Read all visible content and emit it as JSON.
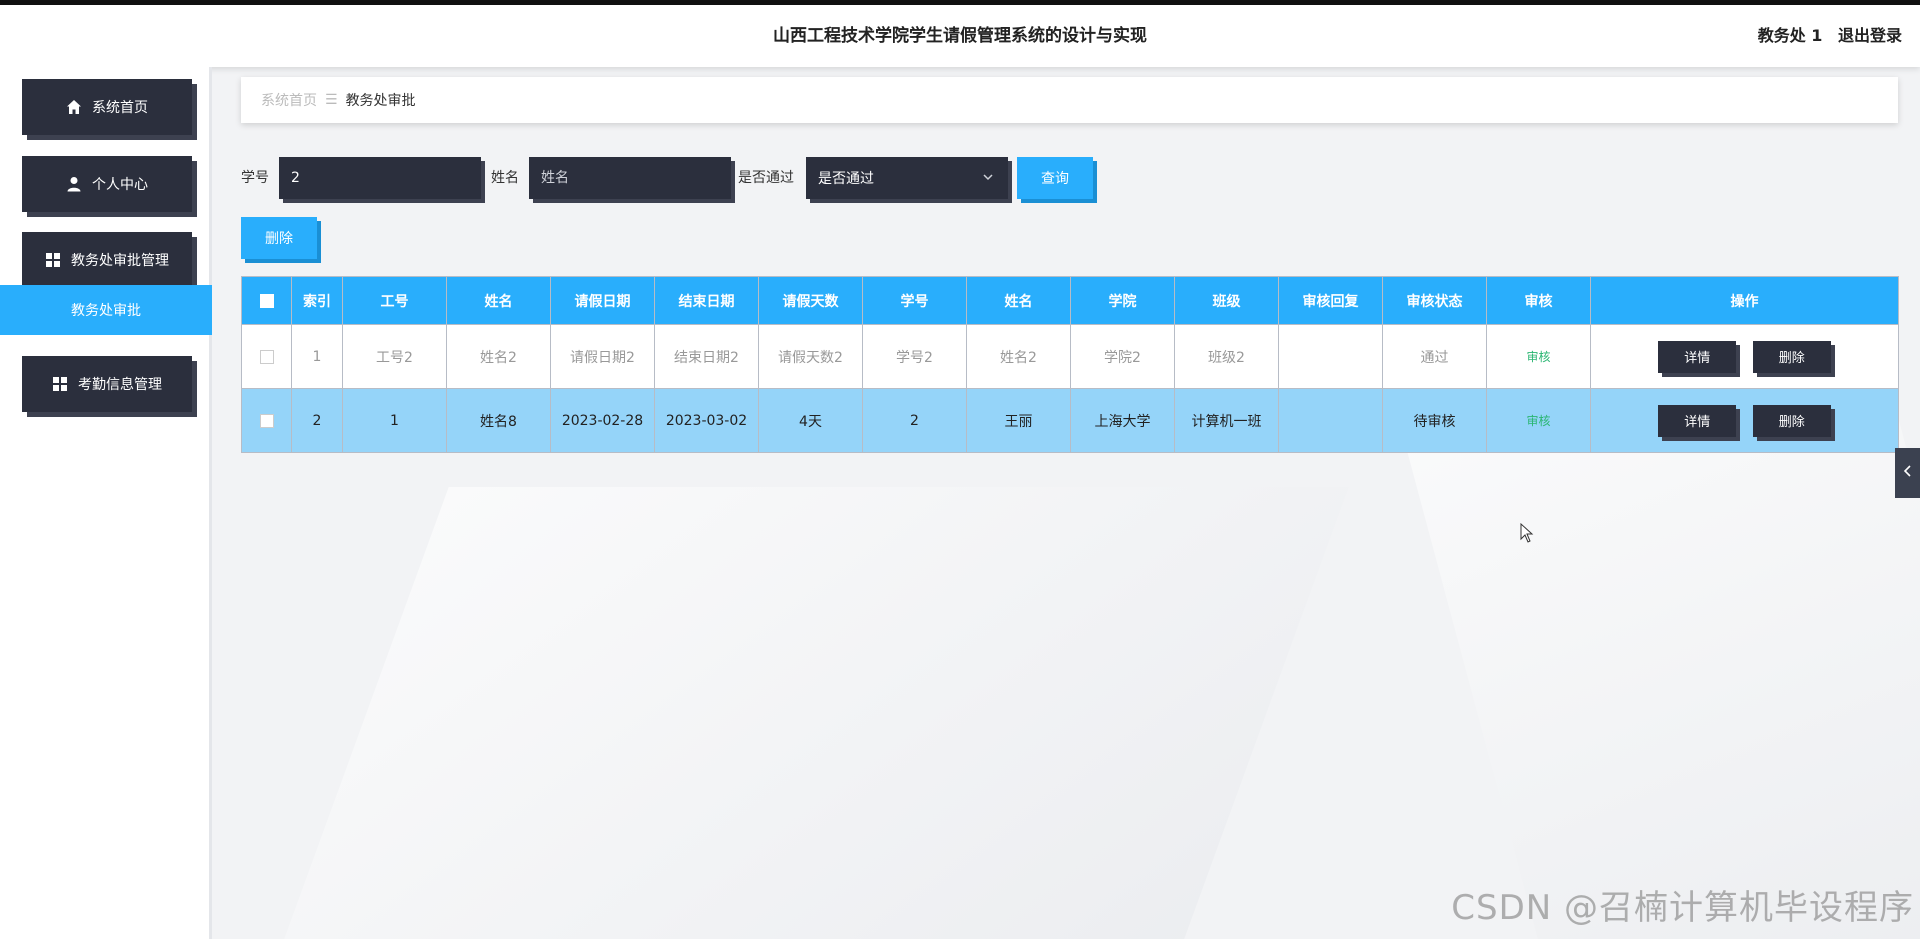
{
  "header": {
    "title": "山西工程技术学院学生请假管理系统的设计与实现",
    "user_name": "教务处 1",
    "logout_label": "退出登录"
  },
  "sidebar": {
    "items": [
      {
        "label": "系统首页",
        "icon": "home-icon"
      },
      {
        "label": "个人中心",
        "icon": "user-icon"
      },
      {
        "label": "教务处审批管理",
        "icon": "grid-icon"
      },
      {
        "label": "教务处审批",
        "icon": null
      },
      {
        "label": "考勤信息管理",
        "icon": "grid-icon"
      }
    ]
  },
  "breadcrumb": {
    "home": "系统首页",
    "separator": "☰",
    "current": "教务处审批"
  },
  "search": {
    "student_no_label": "学号",
    "student_no_value": "2",
    "name_label": "姓名",
    "name_placeholder": "姓名",
    "passed_label": "是否通过",
    "passed_placeholder": "是否通过",
    "query_label": "查询"
  },
  "toolbar": {
    "delete_label": "删除"
  },
  "table": {
    "headers": [
      "索引",
      "工号",
      "姓名",
      "请假日期",
      "结束日期",
      "请假天数",
      "学号",
      "姓名",
      "学院",
      "班级",
      "审核回复",
      "审核状态",
      "审核",
      "操作"
    ],
    "rows": [
      {
        "index": "1",
        "staff_no": "工号2",
        "name": "姓名2",
        "start": "请假日期2",
        "end": "结束日期2",
        "days": "请假天数2",
        "student_no": "学号2",
        "student_name": "姓名2",
        "college": "学院2",
        "class": "班级2",
        "reply": "",
        "status": "通过",
        "audit": "审核"
      },
      {
        "index": "2",
        "staff_no": "1",
        "name": "姓名8",
        "start": "2023-02-28",
        "end": "2023-03-02",
        "days": "4天",
        "student_no": "2",
        "student_name": "王丽",
        "college": "上海大学",
        "class": "计算机一班",
        "reply": "",
        "status": "待审核",
        "audit": "审核"
      }
    ],
    "detail_label": "详情",
    "delete_label": "删除"
  },
  "watermark": "CSDN @召楠计算机毕设程序",
  "colors": {
    "accent": "#29aefc",
    "dark": "#2b2f3d",
    "selected_row": "#95d4f9"
  }
}
